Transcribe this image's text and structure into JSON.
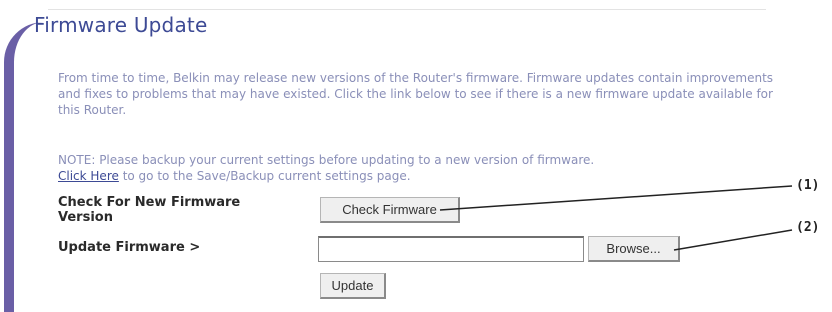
{
  "title": "Firmware Update",
  "intro_text": "From time to time, Belkin may release new versions of the Router's firmware. Firmware updates contain improvements and fixes to problems that may have existed. Click the link below to see if there is a new firmware update available for this Router.",
  "note_text": "NOTE: Please backup your current settings before updating to a new version of firmware.",
  "click_here_link": "Click Here",
  "click_here_suffix": " to go to the Save/Backup current settings page.",
  "check_label": "Check For New Firmware Version",
  "check_button": "Check Firmware",
  "update_label": "Update Firmware >",
  "file_input_value": "",
  "browse_button": "Browse...",
  "update_button": "Update",
  "callouts": [
    "(1)",
    "(2)"
  ],
  "colors": {
    "accent_purple": "#6a5fa6",
    "title_blue": "#3d4a95"
  }
}
